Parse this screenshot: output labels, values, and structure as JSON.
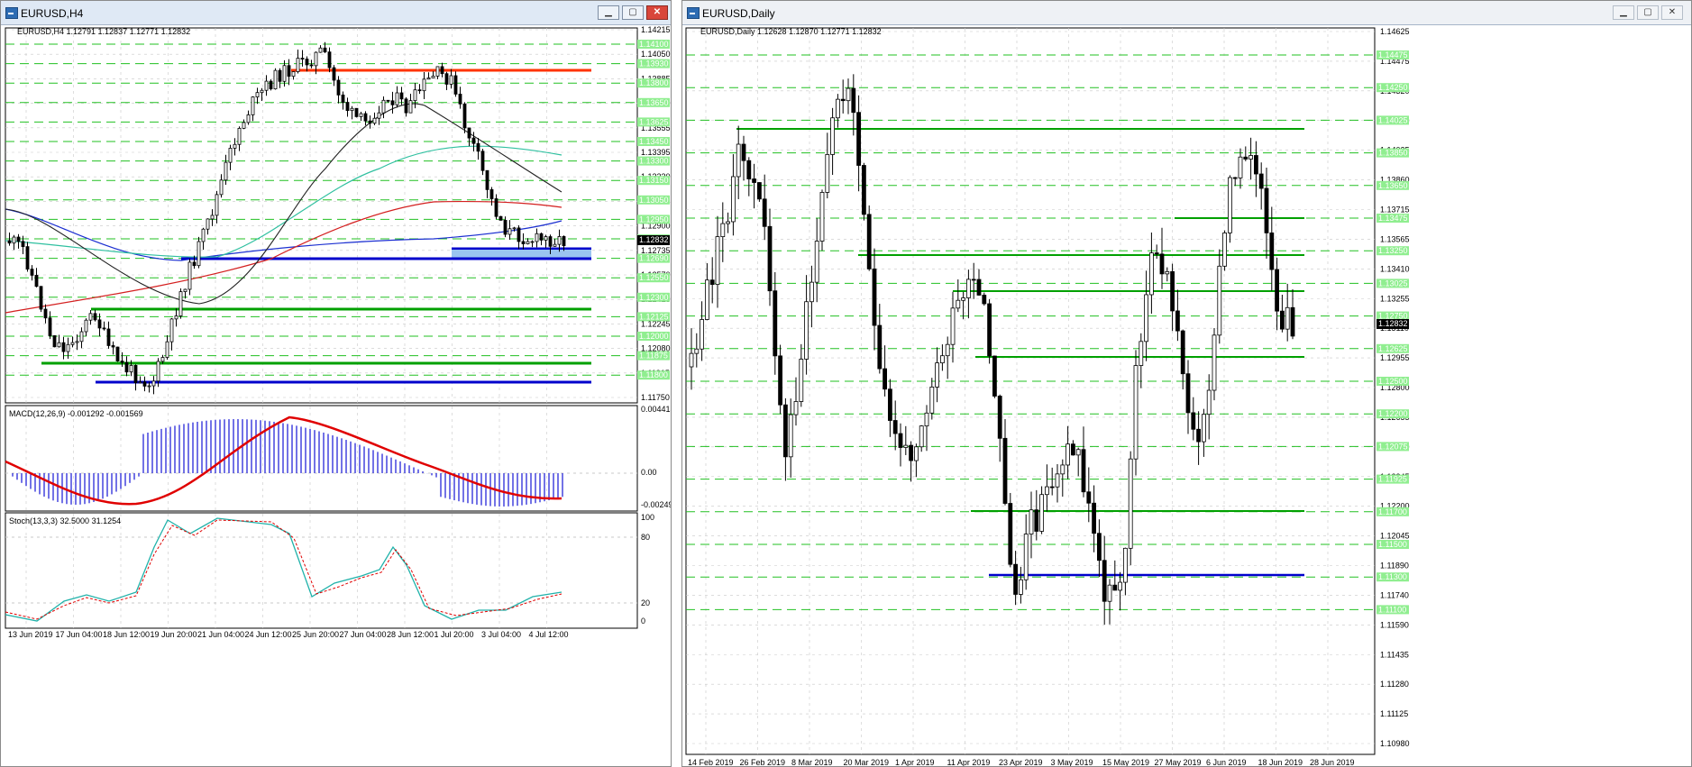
{
  "left_window": {
    "title": "EURUSD,H4",
    "chart_header": "EURUSD,H4  1.12791 1.12837 1.12771 1.12832",
    "price_scale": [
      "1.14215",
      "1.14050",
      "1.13885",
      "1.13720",
      "1.13555",
      "1.13395",
      "1.13230",
      "1.13065",
      "1.12900",
      "1.12735",
      "1.12570",
      "1.12410",
      "1.12245",
      "1.12080",
      "1.11915",
      "1.11750"
    ],
    "level_tags": [
      "1.14100",
      "1.13930",
      "1.13800",
      "1.13650",
      "1.13625",
      "1.13450",
      "1.13300",
      "1.13150",
      "1.13050",
      "1.12950",
      "1.12750",
      "1.12690",
      "1.12550",
      "1.12300",
      "1.12125",
      "1.12000",
      "1.11875",
      "1.11800"
    ],
    "current_price": "1.12832",
    "time_labels": [
      "13 Jun 2019",
      "17 Jun 04:00",
      "18 Jun 12:00",
      "19 Jun 20:00",
      "21 Jun 04:00",
      "24 Jun 12:00",
      "25 Jun 20:00",
      "27 Jun 04:00",
      "28 Jun 12:00",
      "1 Jul 20:00",
      "3 Jul 04:00",
      "4 Jul 12:00"
    ],
    "macd": {
      "label": "MACD(12,26,9) -0.001292 -0.001569",
      "scale": [
        "0.004413",
        "0.00",
        "-0.002493"
      ]
    },
    "stoch": {
      "label": "Stoch(13,3,3) 32.5000 31.1254",
      "scale": [
        "100",
        "80",
        "20",
        "0"
      ]
    }
  },
  "right_window": {
    "title": "EURUSD,Daily",
    "chart_header": "EURUSD,Daily  1.12628 1.12870 1.12771 1.12832",
    "price_scale": [
      "1.14625",
      "1.14475",
      "1.14320",
      "1.14170",
      "1.14025",
      "1.13860",
      "1.13715",
      "1.13565",
      "1.13410",
      "1.13255",
      "1.13110",
      "1.12955",
      "1.12800",
      "1.12655",
      "1.12500",
      "1.12345",
      "1.12200",
      "1.12045",
      "1.11890",
      "1.11740",
      "1.11590",
      "1.11435",
      "1.11280",
      "1.11125",
      "1.10980"
    ],
    "level_tags": [
      "1.14475",
      "1.14250",
      "1.14025",
      "1.13850",
      "1.13650",
      "1.13475",
      "1.13250",
      "1.13025",
      "1.12750",
      "1.12625",
      "1.12500",
      "1.12200",
      "1.12075",
      "1.11925",
      "1.11700",
      "1.11500",
      "1.11300",
      "1.11100"
    ],
    "current_price": "1.12832",
    "time_labels": [
      "14 Feb 2019",
      "26 Feb 2019",
      "8 Mar 2019",
      "20 Mar 2019",
      "1 Apr 2019",
      "11 Apr 2019",
      "23 Apr 2019",
      "3 May 2019",
      "15 May 2019",
      "27 May 2019",
      "6 Jun 2019",
      "18 Jun 2019",
      "28 Jun 2019"
    ]
  },
  "colors": {
    "bull_line": "#00a000",
    "resistance": "#ff3300",
    "support": "#0000cc",
    "tag_bg": "#90ee90",
    "macd_hist": "#1515d6",
    "macd_signal": "#e00000",
    "stoch_main": "#20b2aa",
    "stoch_signal": "#e00000"
  }
}
